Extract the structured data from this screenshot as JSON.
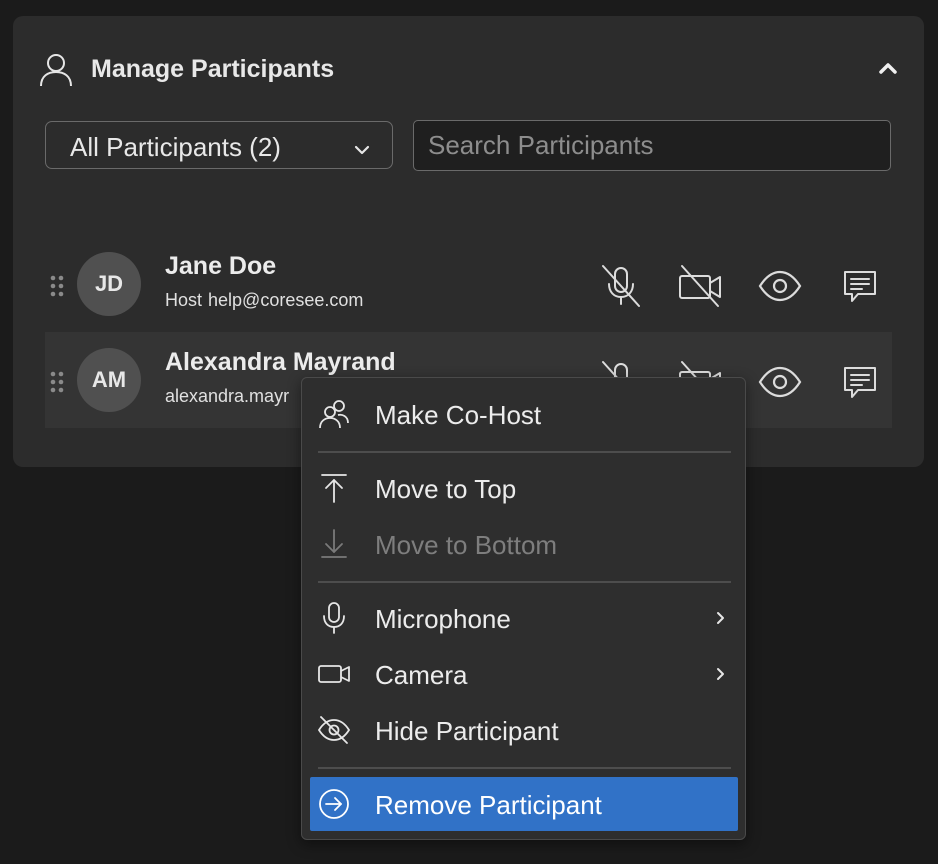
{
  "panel": {
    "title": "Manage Participants",
    "header_icon": "user-icon",
    "collapse_icon": "chevron-up-icon"
  },
  "filter": {
    "selected": "All Participants (2)",
    "icon": "chevron-down-icon"
  },
  "search": {
    "placeholder": "Search Participants",
    "value": ""
  },
  "participants": [
    {
      "initials": "JD",
      "name": "Jane Doe",
      "role": "Host",
      "email": "help@coresee.com",
      "mic": "muted",
      "camera": "off"
    },
    {
      "initials": "AM",
      "name": "Alexandra Mayrand",
      "role": "",
      "email": "alexandra.mayr",
      "mic": "muted",
      "camera": "off"
    }
  ],
  "context_menu": {
    "items": [
      {
        "label": "Make Co-Host",
        "icon": "co-host-icon"
      },
      {
        "label": "Move to Top",
        "icon": "arrow-up-to-line-icon"
      },
      {
        "label": "Move to Bottom",
        "icon": "arrow-down-to-line-icon",
        "disabled": true
      },
      {
        "label": "Microphone",
        "icon": "microphone-icon",
        "submenu": true
      },
      {
        "label": "Camera",
        "icon": "camera-icon",
        "submenu": true
      },
      {
        "label": "Hide Participant",
        "icon": "eye-off-icon"
      },
      {
        "label": "Remove Participant",
        "icon": "exit-icon",
        "highlighted": true
      }
    ]
  },
  "colors": {
    "background": "#1b1b1b",
    "panel": "#2c2c2c",
    "highlight": "#3172c7"
  }
}
